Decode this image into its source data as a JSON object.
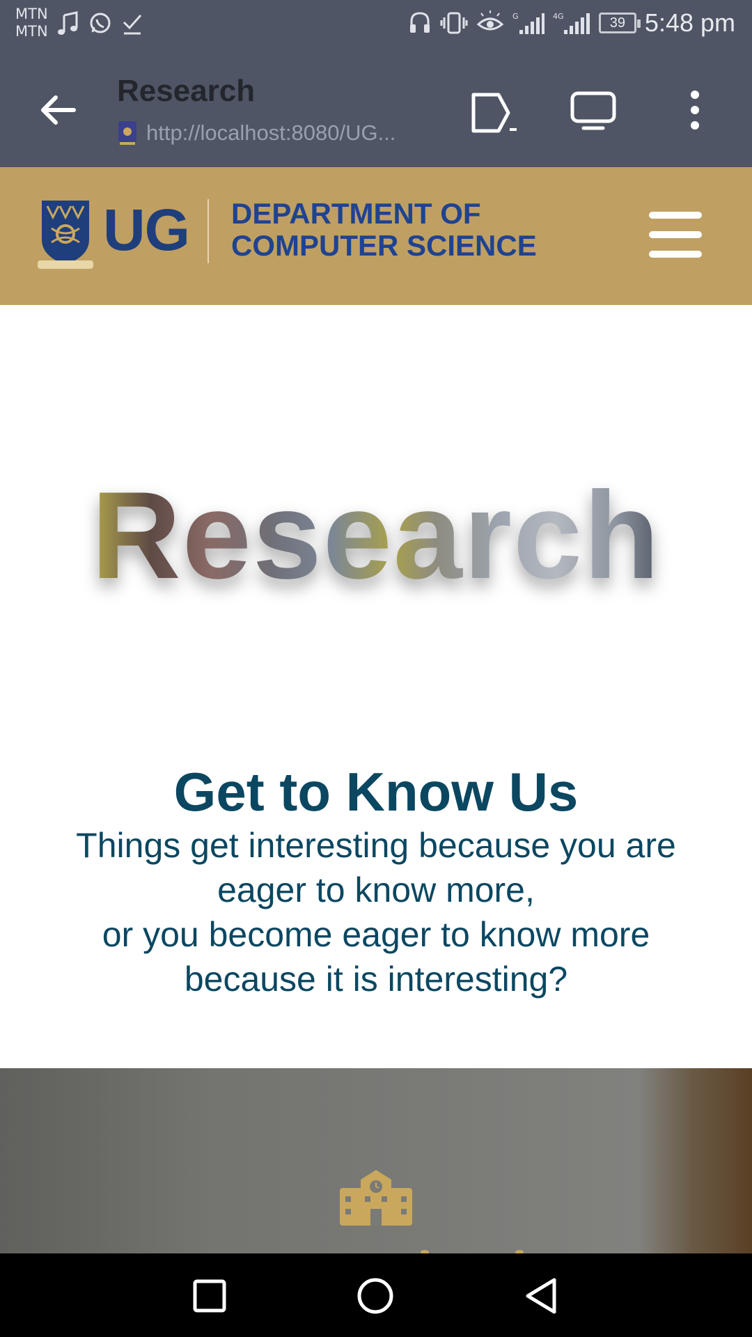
{
  "status_bar": {
    "carriers": [
      "MTN",
      "MTN"
    ],
    "network_type": "4G",
    "battery_level": "39",
    "time": "5:48 pm",
    "left_icons": [
      "music-note-icon",
      "whatsapp-icon",
      "check-download-icon"
    ],
    "right_icons": [
      "headset-icon",
      "vibrate-icon",
      "eye-comfort-icon",
      "signal-icon",
      "signal-4g-icon"
    ]
  },
  "browser": {
    "title": "Research",
    "url": "http://localhost:8080/UG...",
    "icons": [
      "back-arrow-icon",
      "open-tab-icon",
      "cast-screen-icon",
      "overflow-menu-icon"
    ]
  },
  "site_header": {
    "logo_text": "UG",
    "department_line1": "DEPARTMENT OF",
    "department_line2": "COMPUTER SCIENCE",
    "brand_color": "#bfa062",
    "logo_color": "#1f3e7c"
  },
  "hero": {
    "title": "Research"
  },
  "intro": {
    "heading": "Get to Know Us",
    "text_lines": [
      "Things get interesting because you are",
      "eager to know more,",
      "or you become eager to know more",
      "because it is interesting?"
    ],
    "text_color": "#0b4761"
  },
  "feature": {
    "icon": "school-icon",
    "icon_color": "#c9a85e"
  },
  "nav_bar": {
    "icons": [
      "recent-apps-icon",
      "home-icon",
      "back-icon"
    ]
  }
}
